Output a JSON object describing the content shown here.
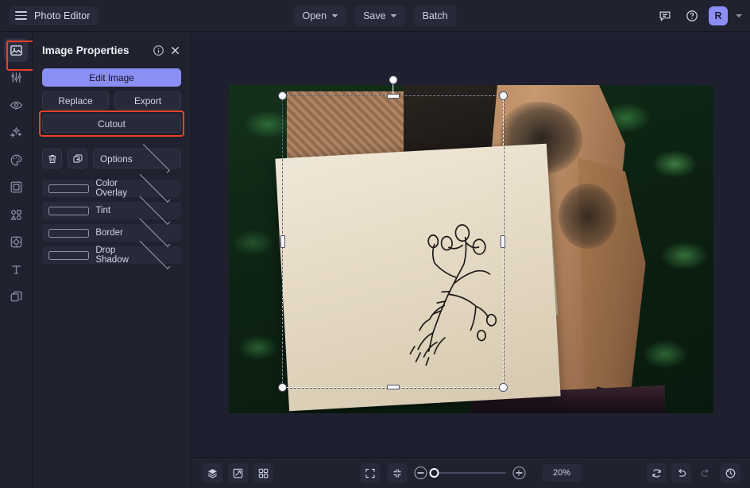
{
  "app": {
    "name": "Photo Editor",
    "menu_icon": "hamburger-icon"
  },
  "topbar": {
    "open_label": "Open",
    "save_label": "Save",
    "batch_label": "Batch",
    "comment_icon": "comment-icon",
    "help_icon": "help-circle-icon",
    "avatar_initial": "R",
    "accent_color": "#8b8ef5"
  },
  "sidebar": {
    "items": [
      {
        "icon": "image-icon",
        "name": "image",
        "active": true
      },
      {
        "icon": "adjustments-icon",
        "name": "adjustments",
        "active": false
      },
      {
        "icon": "eye-icon",
        "name": "visibility",
        "active": false
      },
      {
        "icon": "sparkles-icon",
        "name": "effects",
        "active": false
      },
      {
        "icon": "palette-icon",
        "name": "color",
        "active": false
      },
      {
        "icon": "frame-icon",
        "name": "frame",
        "active": false
      },
      {
        "icon": "shapes-icon",
        "name": "shapes",
        "active": false
      },
      {
        "icon": "mask-icon",
        "name": "mask",
        "active": false
      },
      {
        "icon": "text-icon",
        "name": "text",
        "active": false
      },
      {
        "icon": "layers-copy-icon",
        "name": "duplicate",
        "active": false
      }
    ],
    "highlight_color": "#e8412a"
  },
  "panel": {
    "title": "Image Properties",
    "info_icon": "info-icon",
    "close_icon": "close-icon",
    "edit_image_label": "Edit Image",
    "replace_label": "Replace",
    "export_label": "Export",
    "cutout_label": "Cutout",
    "cutout_highlighted": true,
    "delete_icon": "trash-icon",
    "duplicate_icon": "duplicate-icon",
    "options_label": "Options",
    "effects": [
      {
        "label": "Color Overlay",
        "checked": false
      },
      {
        "label": "Tint",
        "checked": false
      },
      {
        "label": "Border",
        "checked": false
      },
      {
        "label": "Drop Shadow",
        "checked": false
      }
    ]
  },
  "canvas": {
    "image_alt": "Shirtless tattooed man in front of green foliage with a botanical skeleton-hand ink drawing on aged paper overlaid",
    "selection": {
      "active": true,
      "handles": 8,
      "rotation_handle": true
    }
  },
  "bottombar": {
    "layers_icon": "layers-icon",
    "transform_icon": "transform-icon",
    "grid_icon": "grid-icon",
    "fit_icon": "fit-screen-icon",
    "collapse_icon": "collapse-icon",
    "zoom_out_icon": "zoom-out-icon",
    "zoom_in_icon": "zoom-in-icon",
    "zoom_value": "20%",
    "zoom_percent": 20,
    "refresh_icon": "refresh-icon",
    "undo_icon": "undo-icon",
    "redo_icon": "redo-icon",
    "history_icon": "history-icon"
  }
}
